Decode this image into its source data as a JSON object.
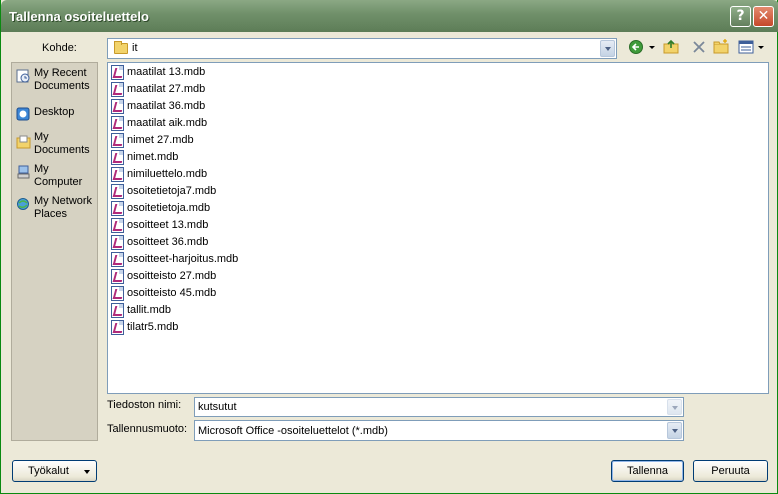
{
  "window": {
    "title": "Tallenna osoiteluettelo",
    "help_symbol": "?",
    "close_symbol": "✕"
  },
  "location": {
    "label": "Kohde:",
    "folder": "it"
  },
  "toolbar": {
    "back_icon": "back-arrow-icon",
    "up_icon": "up-folder-icon",
    "delete_icon": "delete-icon",
    "new_folder_icon": "new-folder-icon",
    "views_icon": "views-icon"
  },
  "places": [
    {
      "label": "My Recent Documents",
      "icon": "recent-documents-icon"
    },
    {
      "label": "Desktop",
      "icon": "desktop-icon"
    },
    {
      "label": "My Documents",
      "icon": "my-documents-icon"
    },
    {
      "label": "My Computer",
      "icon": "my-computer-icon"
    },
    {
      "label": "My Network Places",
      "icon": "network-places-icon"
    }
  ],
  "files": [
    "maatilat 13.mdb",
    "maatilat 27.mdb",
    "maatilat 36.mdb",
    "maatilat aik.mdb",
    "nimet 27.mdb",
    "nimet.mdb",
    "nimiluettelo.mdb",
    "osoitetietoja7.mdb",
    "osoitetietoja.mdb",
    "osoitteet 13.mdb",
    "osoitteet 36.mdb",
    "osoitteet-harjoitus.mdb",
    "osoitteisto 27.mdb",
    "osoitteisto 45.mdb",
    "tallit.mdb",
    "tilatr5.mdb"
  ],
  "filename": {
    "label": "Tiedoston nimi:",
    "value": "kutsutut"
  },
  "filetype": {
    "label": "Tallennusmuoto:",
    "value": "Microsoft Office -osoiteluettelot (*.mdb)"
  },
  "buttons": {
    "tools": "Työkalut",
    "save": "Tallenna",
    "cancel": "Peruuta"
  },
  "colors": {
    "titlebar": "#6f8f69",
    "dialog_bg": "#ece9d8",
    "field_border": "#7f9db9"
  }
}
